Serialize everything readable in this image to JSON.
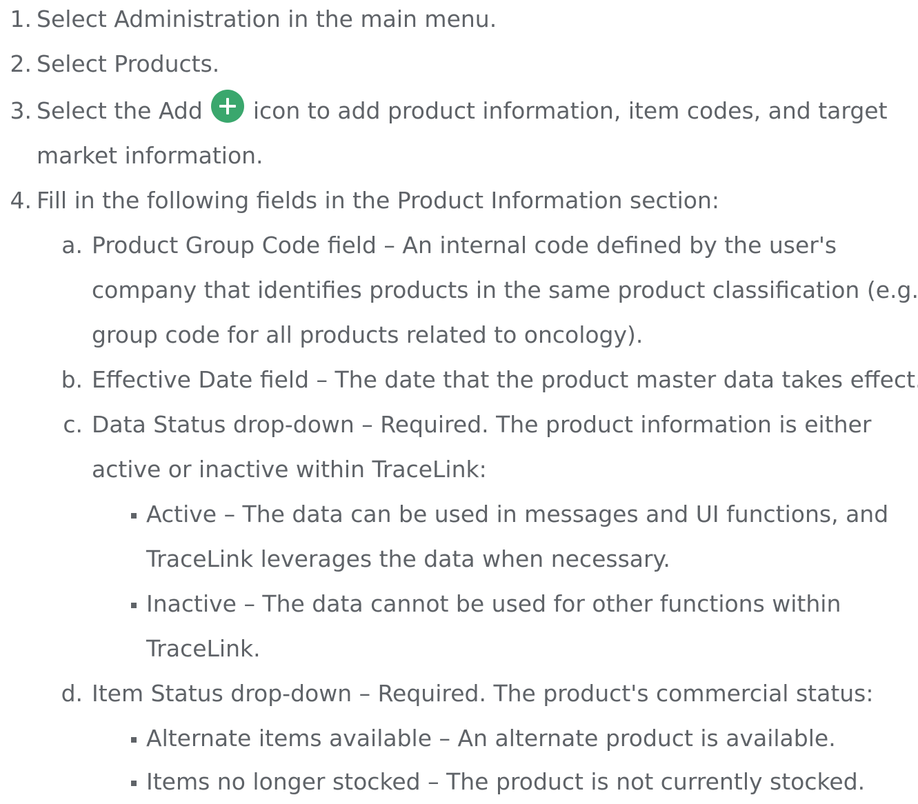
{
  "steps": [
    {
      "marker": "1.",
      "text": "Select Administration in the main menu."
    },
    {
      "marker": "2.",
      "text": "Select Products."
    },
    {
      "marker": "3.",
      "text_before_icon": "Select the Add",
      "icon": "add-circle-icon",
      "icon_color": "#3aa76d",
      "text_after_icon": "icon to add product information, item codes, and target",
      "text_continued": "market information."
    },
    {
      "marker": "4.",
      "text": "Fill in the following fields in the Product Information section:"
    }
  ],
  "fields": [
    {
      "marker": "a.",
      "lines": [
        "Product Group Code field – An internal code defined by the user's",
        "company that identifies products in the same product classification (e.g.",
        "group code for all products related to oncology)."
      ]
    },
    {
      "marker": "b.",
      "lines": [
        "Effective Date field – The date that the product master data takes effect."
      ]
    },
    {
      "marker": "c.",
      "lines": [
        "Data Status drop-down – Required. The product information is either",
        "active or inactive within TraceLink:"
      ],
      "options": [
        {
          "lines": [
            "Active – The data can be used in messages and UI functions, and",
            "TraceLink leverages the data when necessary."
          ]
        },
        {
          "lines": [
            "Inactive – The data cannot be used for other functions within",
            "TraceLink."
          ]
        }
      ]
    },
    {
      "marker": "d.",
      "lines": [
        "Item Status drop-down – Required. The product's commercial status:"
      ],
      "options": [
        {
          "lines": [
            "Alternate items available – An alternate product is available."
          ]
        },
        {
          "lines": [
            "Items no longer stocked – The product is not currently stocked."
          ]
        }
      ]
    }
  ]
}
